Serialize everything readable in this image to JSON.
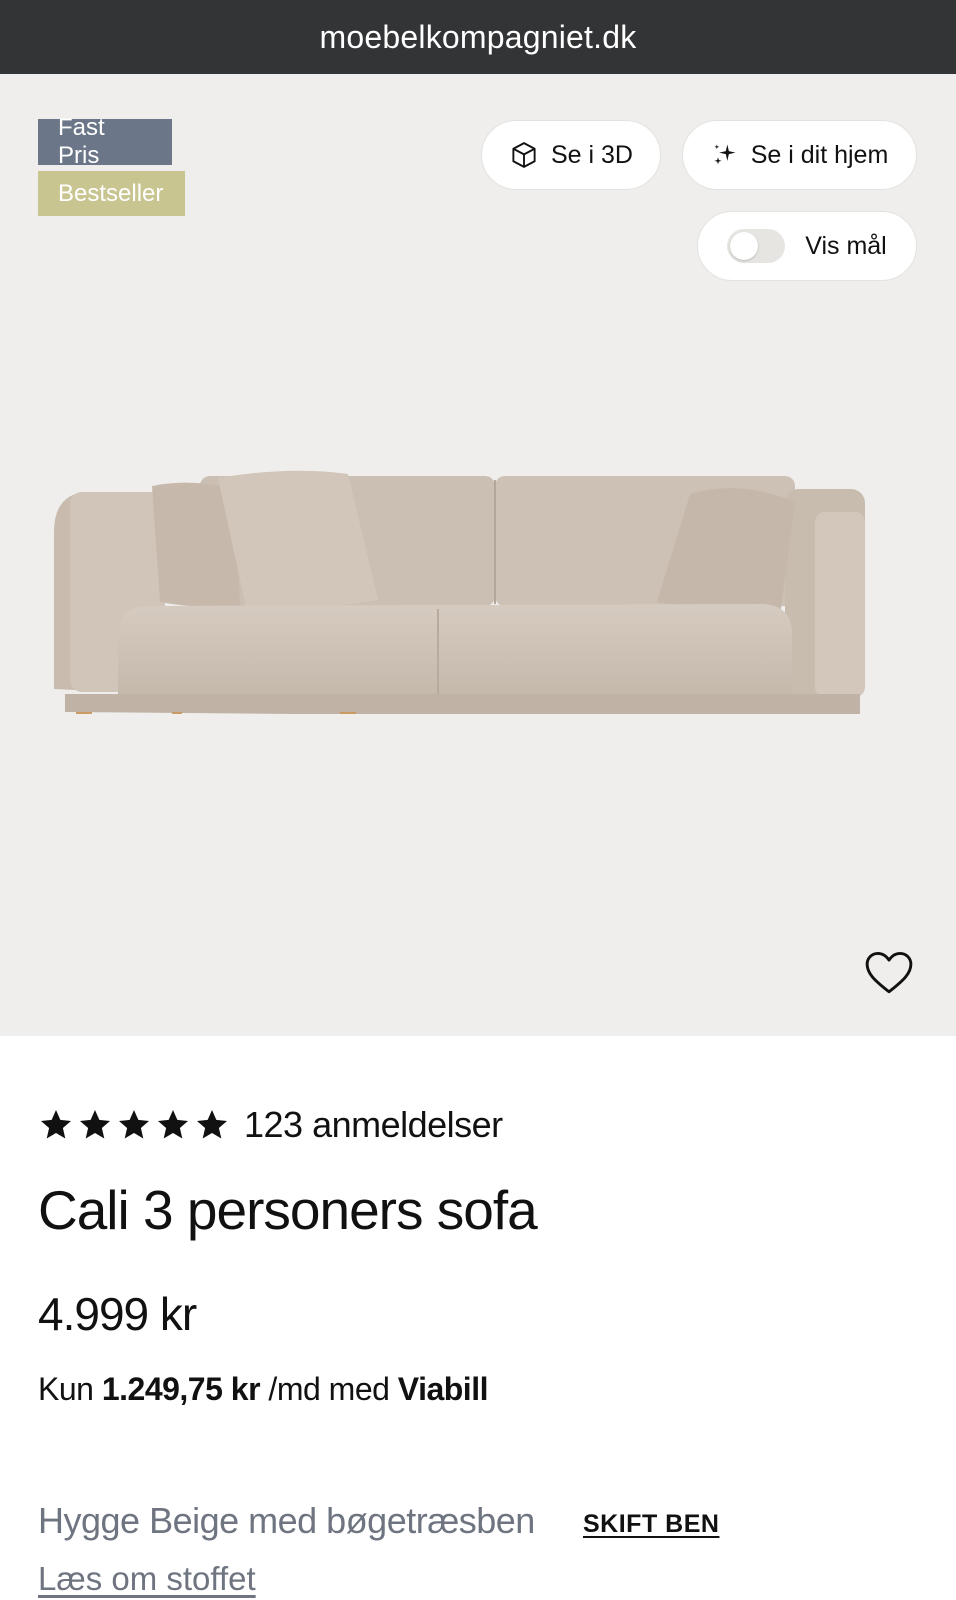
{
  "browser": {
    "url": "moebelkompagniet.dk"
  },
  "badges": {
    "fixed_price": "Fast Pris",
    "bestseller": "Bestseller"
  },
  "actions": {
    "view_3d": "Se i 3D",
    "view_in_home": "Se i dit hjem",
    "show_measurements": "Vis mål",
    "show_measurements_on": false
  },
  "product": {
    "rating_stars": 5,
    "reviews": "123 anmeldelser",
    "name": "Cali 3 personers sofa",
    "price": "4.999 kr",
    "financing": {
      "prefix": "Kun",
      "amount": "1.249,75 kr",
      "middle": "/md med",
      "provider": "Viabill"
    },
    "variant": "Hygge Beige med bøgetræsben",
    "change_legs": "SKIFT BEN",
    "fabric_link": "Læs om stoffet"
  },
  "icons": [
    "cube-icon",
    "sparkle-icon",
    "toggle-switch",
    "heart-icon",
    "star-icon"
  ],
  "colors": {
    "url_bar": "#333436",
    "hero_bg": "#efeeec",
    "badge_fixed_price": "#6b7789",
    "badge_bestseller": "#c9c590",
    "sofa_fabric": "#cfc3b7",
    "sofa_legs": "#c99a62",
    "muted_text": "#6e7480"
  }
}
